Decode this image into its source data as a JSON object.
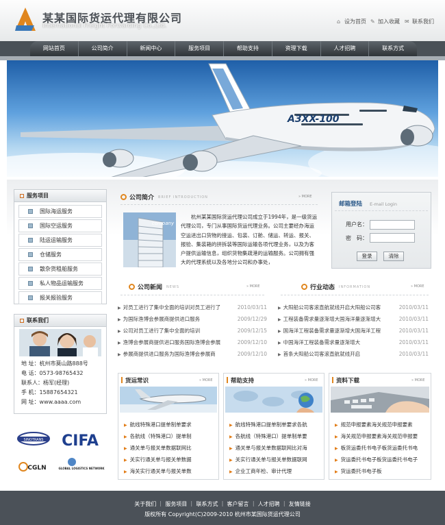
{
  "header": {
    "company_cn": "某某国际货运代理有限公司",
    "company_en": "International Freight Forwarding Co.,Ltd.",
    "links": [
      {
        "label": "设为首页",
        "icon": "home-icon"
      },
      {
        "label": "加入收藏",
        "icon": "bookmark-icon"
      },
      {
        "label": "联系我们",
        "icon": "contact-icon"
      }
    ]
  },
  "nav": [
    "网站首页",
    "公司简介",
    "新闻中心",
    "服务项目",
    "帮助支持",
    "资理下载",
    "人才招聘",
    "联系方式"
  ],
  "banner": {
    "plane_text": "A3XX-100"
  },
  "services": {
    "title": "服务项目",
    "items": [
      "国际海运服务",
      "国际空运服务",
      "陆运运输服务",
      "仓储服务",
      "散杂货租船服务",
      "私人物品运输服务",
      "报关报验服务"
    ]
  },
  "contact": {
    "title": "联系我们",
    "lines": [
      "地 址：杭州市莫山路888号",
      "电 话：0573-98765432",
      "联系人：杨军(经理)",
      "手 机：15887654321",
      "网 址：www.aaaa.com"
    ]
  },
  "partners": [
    "SINOTRANS",
    "CIFA",
    "CGLN",
    "GLOBAL LOGISTICS NETWORK"
  ],
  "about": {
    "title": "公司简介",
    "subtitle": "BRIEF INTRODUCTION",
    "more": "» MORE",
    "image_text": "company",
    "text": "杭州某某国际货运代理公司成立于1994年，是一级货运代理公司，专门从事国际货运代理业务。公司主要经办海运空运进出口货物的接运、包装、订舱、储运、转运、报关、报验、集装箱的拼拆装等国际运输各项代理业务，以及为客户提供运输信息，组织货物集疏港的运输服务。公司拥有强大的代理系统以及各地分公司和办事处，"
  },
  "login": {
    "title": "邮箱登陆",
    "subtitle": "E-mail Login",
    "user_label": "用户名：",
    "pass_label": "密　码：",
    "login_btn": "登录",
    "clear_btn": "清除"
  },
  "news": {
    "title": "公司新闻",
    "subtitle": "NEWS",
    "more": "» MORE",
    "items": [
      {
        "text": "对员工进行了集中全面的培训对员工进行了",
        "date": "2010/03/11"
      },
      {
        "text": "为国际渔博会参展商提供进口服务",
        "date": "2009/12/29"
      },
      {
        "text": "公司对员工进行了集中全面的培训",
        "date": "2009/12/15"
      },
      {
        "text": "渔博会参展商提供进口服务国际渔博会参展",
        "date": "2009/12/10"
      },
      {
        "text": "参展商提供进口服务为国际渔博会参展商",
        "date": "2009/12/10"
      }
    ]
  },
  "industry": {
    "title": "行业动态",
    "subtitle": "INFORMATION",
    "more": "» MORE",
    "items": [
      {
        "text": "大阳船公司客滚直航就线开启大阳船公司客",
        "date": "2010/03/11"
      },
      {
        "text": "工程装备需求量逐渐增大国海洋量逐渐增大",
        "date": "2010/03/11"
      },
      {
        "text": "国海洋工程装备需求量逐渐增大国海洋工程",
        "date": "2010/03/11"
      },
      {
        "text": "中国海洋工程装备需求量逐渐增大",
        "date": "2010/03/11"
      },
      {
        "text": "首条大阳船公司客滚直航就线开启",
        "date": "2010/03/11"
      }
    ]
  },
  "freight": {
    "title": "货运常识",
    "more": "» MORE",
    "items": [
      "航线特殊港口提单制单要求",
      "各航线（特殊港口）提单制",
      "通关单与报关单数据联网比",
      "关实行通关单与报关单数据",
      "海关实行通关单与报关单数"
    ]
  },
  "support": {
    "title": "帮助支持",
    "more": "» MORE",
    "items": [
      "航线特殊港口提单制单要求各航",
      "各航线（特殊港口）提单制单要",
      "通关单与报关单数据联网比对海",
      "关实行通关单与报关单数据联网",
      "企业工商年检、审计代理"
    ]
  },
  "download": {
    "title": "资料下载",
    "more": "» MORE",
    "items": [
      "规范申报要素海关规范申报要素",
      "海关规范申报要素海关规范申报要",
      "板货运委托书电子板货运委托书电",
      "货运委托书电子板货运委托书电子",
      "货运委托书电子板"
    ]
  },
  "footer": {
    "links": [
      "关于我们",
      "服务项目",
      "联系方式",
      "客户留言",
      "人才招聘",
      "友情链接"
    ],
    "copyright": "版权所有  Copyright(C)2009-2010 杭州市某国际货运代理公司"
  },
  "colors": {
    "accent": "#e0861e",
    "nav_bg": "#3a4045",
    "footer_bg": "#4b5158",
    "heading_blue": "#2c5a8a"
  }
}
